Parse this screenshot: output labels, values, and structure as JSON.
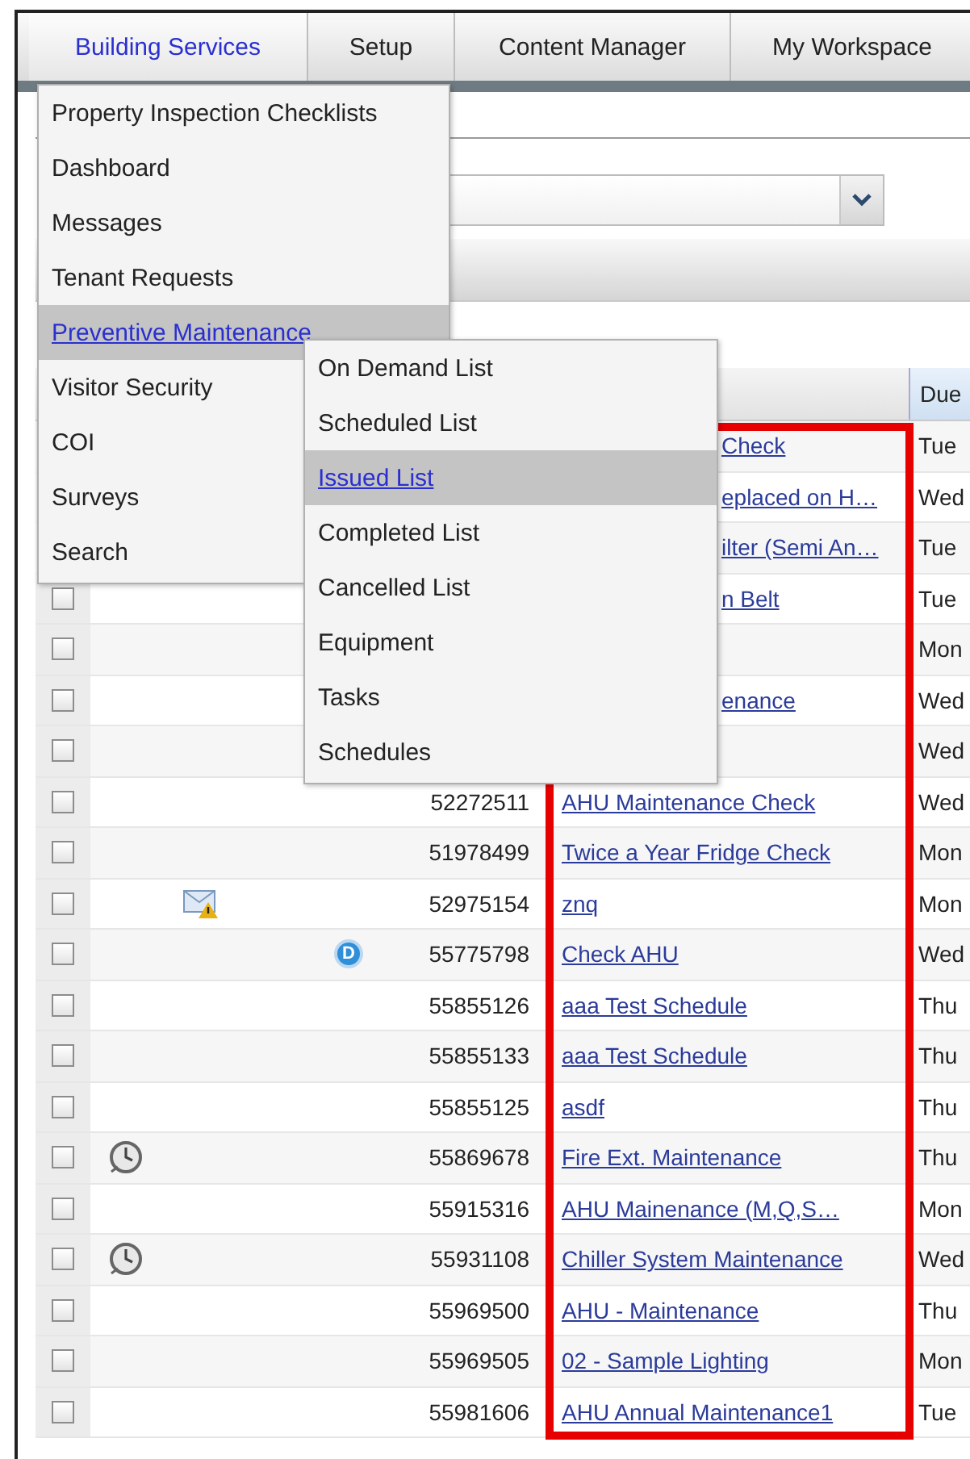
{
  "nav_tabs": [
    {
      "label": "Building Services",
      "selected": true
    },
    {
      "label": "Setup",
      "selected": false
    },
    {
      "label": "Content Manager",
      "selected": false
    },
    {
      "label": "My Workspace",
      "selected": false
    }
  ],
  "menu": {
    "items": [
      {
        "label": "Property Inspection Checklists",
        "selected": false
      },
      {
        "label": "Dashboard",
        "selected": false
      },
      {
        "label": "Messages",
        "selected": false
      },
      {
        "label": "Tenant Requests",
        "selected": false
      },
      {
        "label": "Preventive Maintenance",
        "selected": true
      },
      {
        "label": "Visitor Security",
        "selected": false
      },
      {
        "label": "COI",
        "selected": false
      },
      {
        "label": "Surveys",
        "selected": false
      },
      {
        "label": "Search",
        "selected": false
      }
    ]
  },
  "submenu": {
    "items": [
      {
        "label": "On Demand List",
        "selected": false
      },
      {
        "label": "Scheduled List",
        "selected": false
      },
      {
        "label": "Issued List",
        "selected": true
      },
      {
        "label": "Completed List",
        "selected": false
      },
      {
        "label": "Cancelled List",
        "selected": false
      },
      {
        "label": "Equipment",
        "selected": false
      },
      {
        "label": "Tasks",
        "selected": false
      },
      {
        "label": "Schedules",
        "selected": false
      }
    ]
  },
  "table": {
    "due_header": "Due",
    "highlight_name_column": true,
    "rows": [
      {
        "kind": "partial",
        "name": "Check",
        "due": "Tue"
      },
      {
        "kind": "partial",
        "name": "eplaced on H…",
        "due": "Wed"
      },
      {
        "kind": "partial",
        "name": "ilter (Semi An…",
        "due": "Tue"
      },
      {
        "kind": "partial",
        "checked": false,
        "name": "n Belt",
        "due": "Tue"
      },
      {
        "kind": "partial",
        "checked": false,
        "due": "Mon"
      },
      {
        "kind": "partial",
        "checked": false,
        "name": "enance",
        "due": "Wed"
      },
      {
        "kind": "partial",
        "checked": false,
        "due": "Wed"
      },
      {
        "kind": "full",
        "checked": false,
        "id": "52272511",
        "name": "AHU Maintenance Check",
        "due": "Wed"
      },
      {
        "kind": "full",
        "checked": false,
        "id": "51978499",
        "name": "Twice a Year Fridge Check",
        "due": "Mon"
      },
      {
        "kind": "mail-warning",
        "checked": false,
        "id": "52975154",
        "name": "znq",
        "due": "Mon"
      },
      {
        "kind": "full",
        "checked": false,
        "badge": "D",
        "id": "55775798",
        "name": "Check AHU",
        "due": "Wed"
      },
      {
        "kind": "full",
        "checked": false,
        "id": "55855126",
        "name": "aaa Test Schedule",
        "due": "Thu"
      },
      {
        "kind": "full",
        "checked": false,
        "id": "55855133",
        "name": "aaa Test Schedule",
        "due": "Thu"
      },
      {
        "kind": "full",
        "checked": false,
        "id": "55855125",
        "name": "asdf",
        "due": "Thu"
      },
      {
        "kind": "clock",
        "checked": false,
        "id": "55869678",
        "name": "Fire Ext. Maintenance",
        "due": "Thu"
      },
      {
        "kind": "full",
        "checked": false,
        "id": "55915316",
        "name": "AHU Mainenance (M,Q,S…",
        "due": "Mon"
      },
      {
        "kind": "clock",
        "checked": false,
        "id": "55931108",
        "name": "Chiller System Maintenance",
        "due": "Wed"
      },
      {
        "kind": "full",
        "checked": false,
        "id": "55969500",
        "name": "AHU - Maintenance",
        "due": "Thu"
      },
      {
        "kind": "full",
        "checked": false,
        "id": "55969505",
        "name": "02 - Sample Lighting",
        "due": "Mon"
      },
      {
        "kind": "full",
        "checked": false,
        "id": "55981606",
        "name": "AHU Annual Maintenance1",
        "due": "Tue"
      }
    ]
  }
}
